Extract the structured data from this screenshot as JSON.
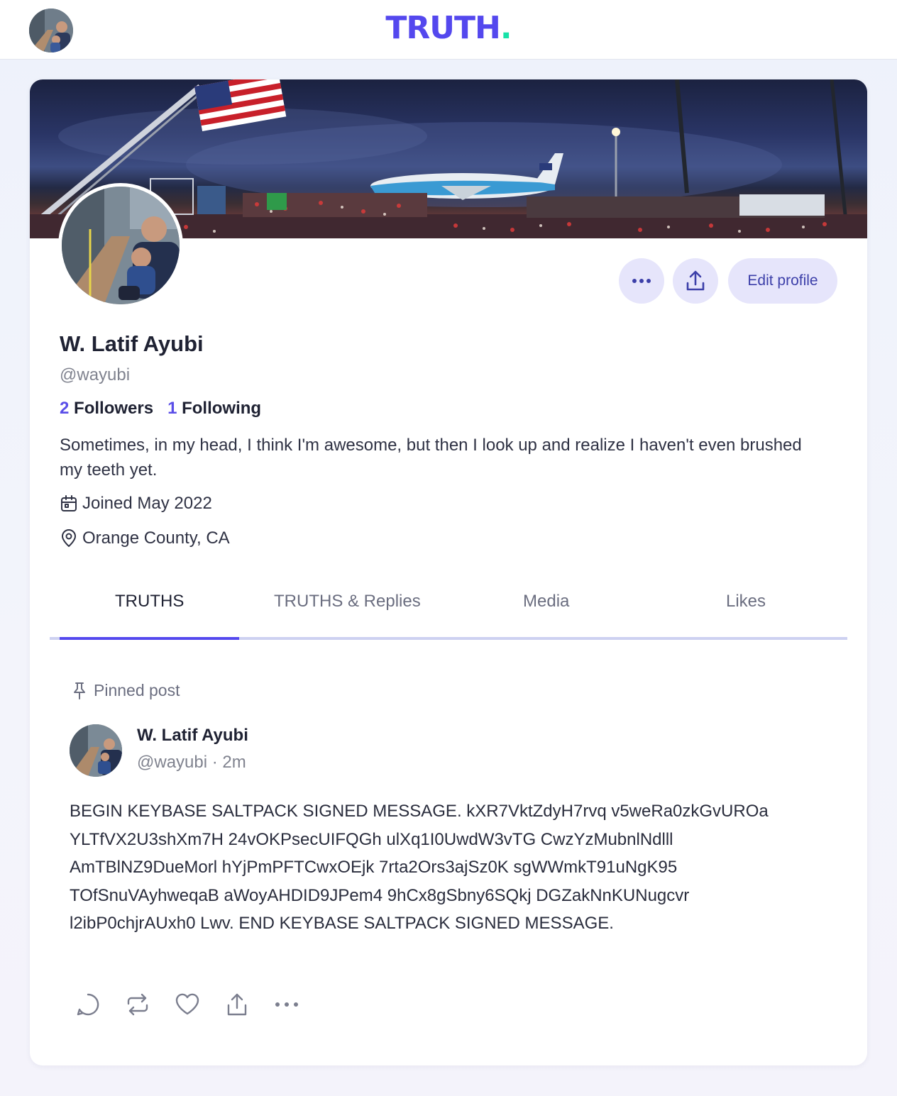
{
  "app": {
    "logo_text": "TRUTH",
    "logo_dot": ".",
    "brand_color": "#5448ee",
    "accent_color": "#17e2a8"
  },
  "profile": {
    "display_name": "W. Latif Ayubi",
    "handle": "@wayubi",
    "followers_count": "2",
    "followers_label": "Followers",
    "following_count": "1",
    "following_label": "Following",
    "bio": "Sometimes, in my head, I think I'm awesome, but then I look up and realize I haven't even brushed my teeth yet.",
    "joined": "Joined May 2022",
    "location": "Orange County, CA",
    "edit_button": "Edit profile"
  },
  "tabs": [
    {
      "label": "TRUTHS",
      "active": true
    },
    {
      "label": "TRUTHS & Replies",
      "active": false
    },
    {
      "label": "Media",
      "active": false
    },
    {
      "label": "Likes",
      "active": false
    }
  ],
  "post": {
    "pinned_label": "Pinned post",
    "author": "W. Latif Ayubi",
    "handle_time": "@wayubi · 2m",
    "body": "BEGIN KEYBASE SALTPACK SIGNED MESSAGE. kXR7VktZdyH7rvq v5weRa0zkGvUROa YLTfVX2U3shXm7H 24vOKPsecUIFQGh ulXq1I0UwdW3vTG CwzYzMubnlNdlll AmTBlNZ9DueMorl hYjPmPFTCwxOEjk 7rta2Ors3ajSz0K sgWWmkT91uNgK95 TOfSnuVAyhweqaB aWoyAHDID9JPem4 9hCx8gSbny6SQkj DGZakNnKUNugcvr l2ibP0chjrAUxh0 Lwv. END KEYBASE SALTPACK SIGNED MESSAGE."
  },
  "icons": {
    "more": "ellipsis-icon",
    "share": "upload-share-icon",
    "calendar": "calendar-icon",
    "location": "map-pin-icon",
    "pin": "pin-icon",
    "reply": "comment-icon",
    "retruth": "repost-icon",
    "like": "heart-icon"
  }
}
